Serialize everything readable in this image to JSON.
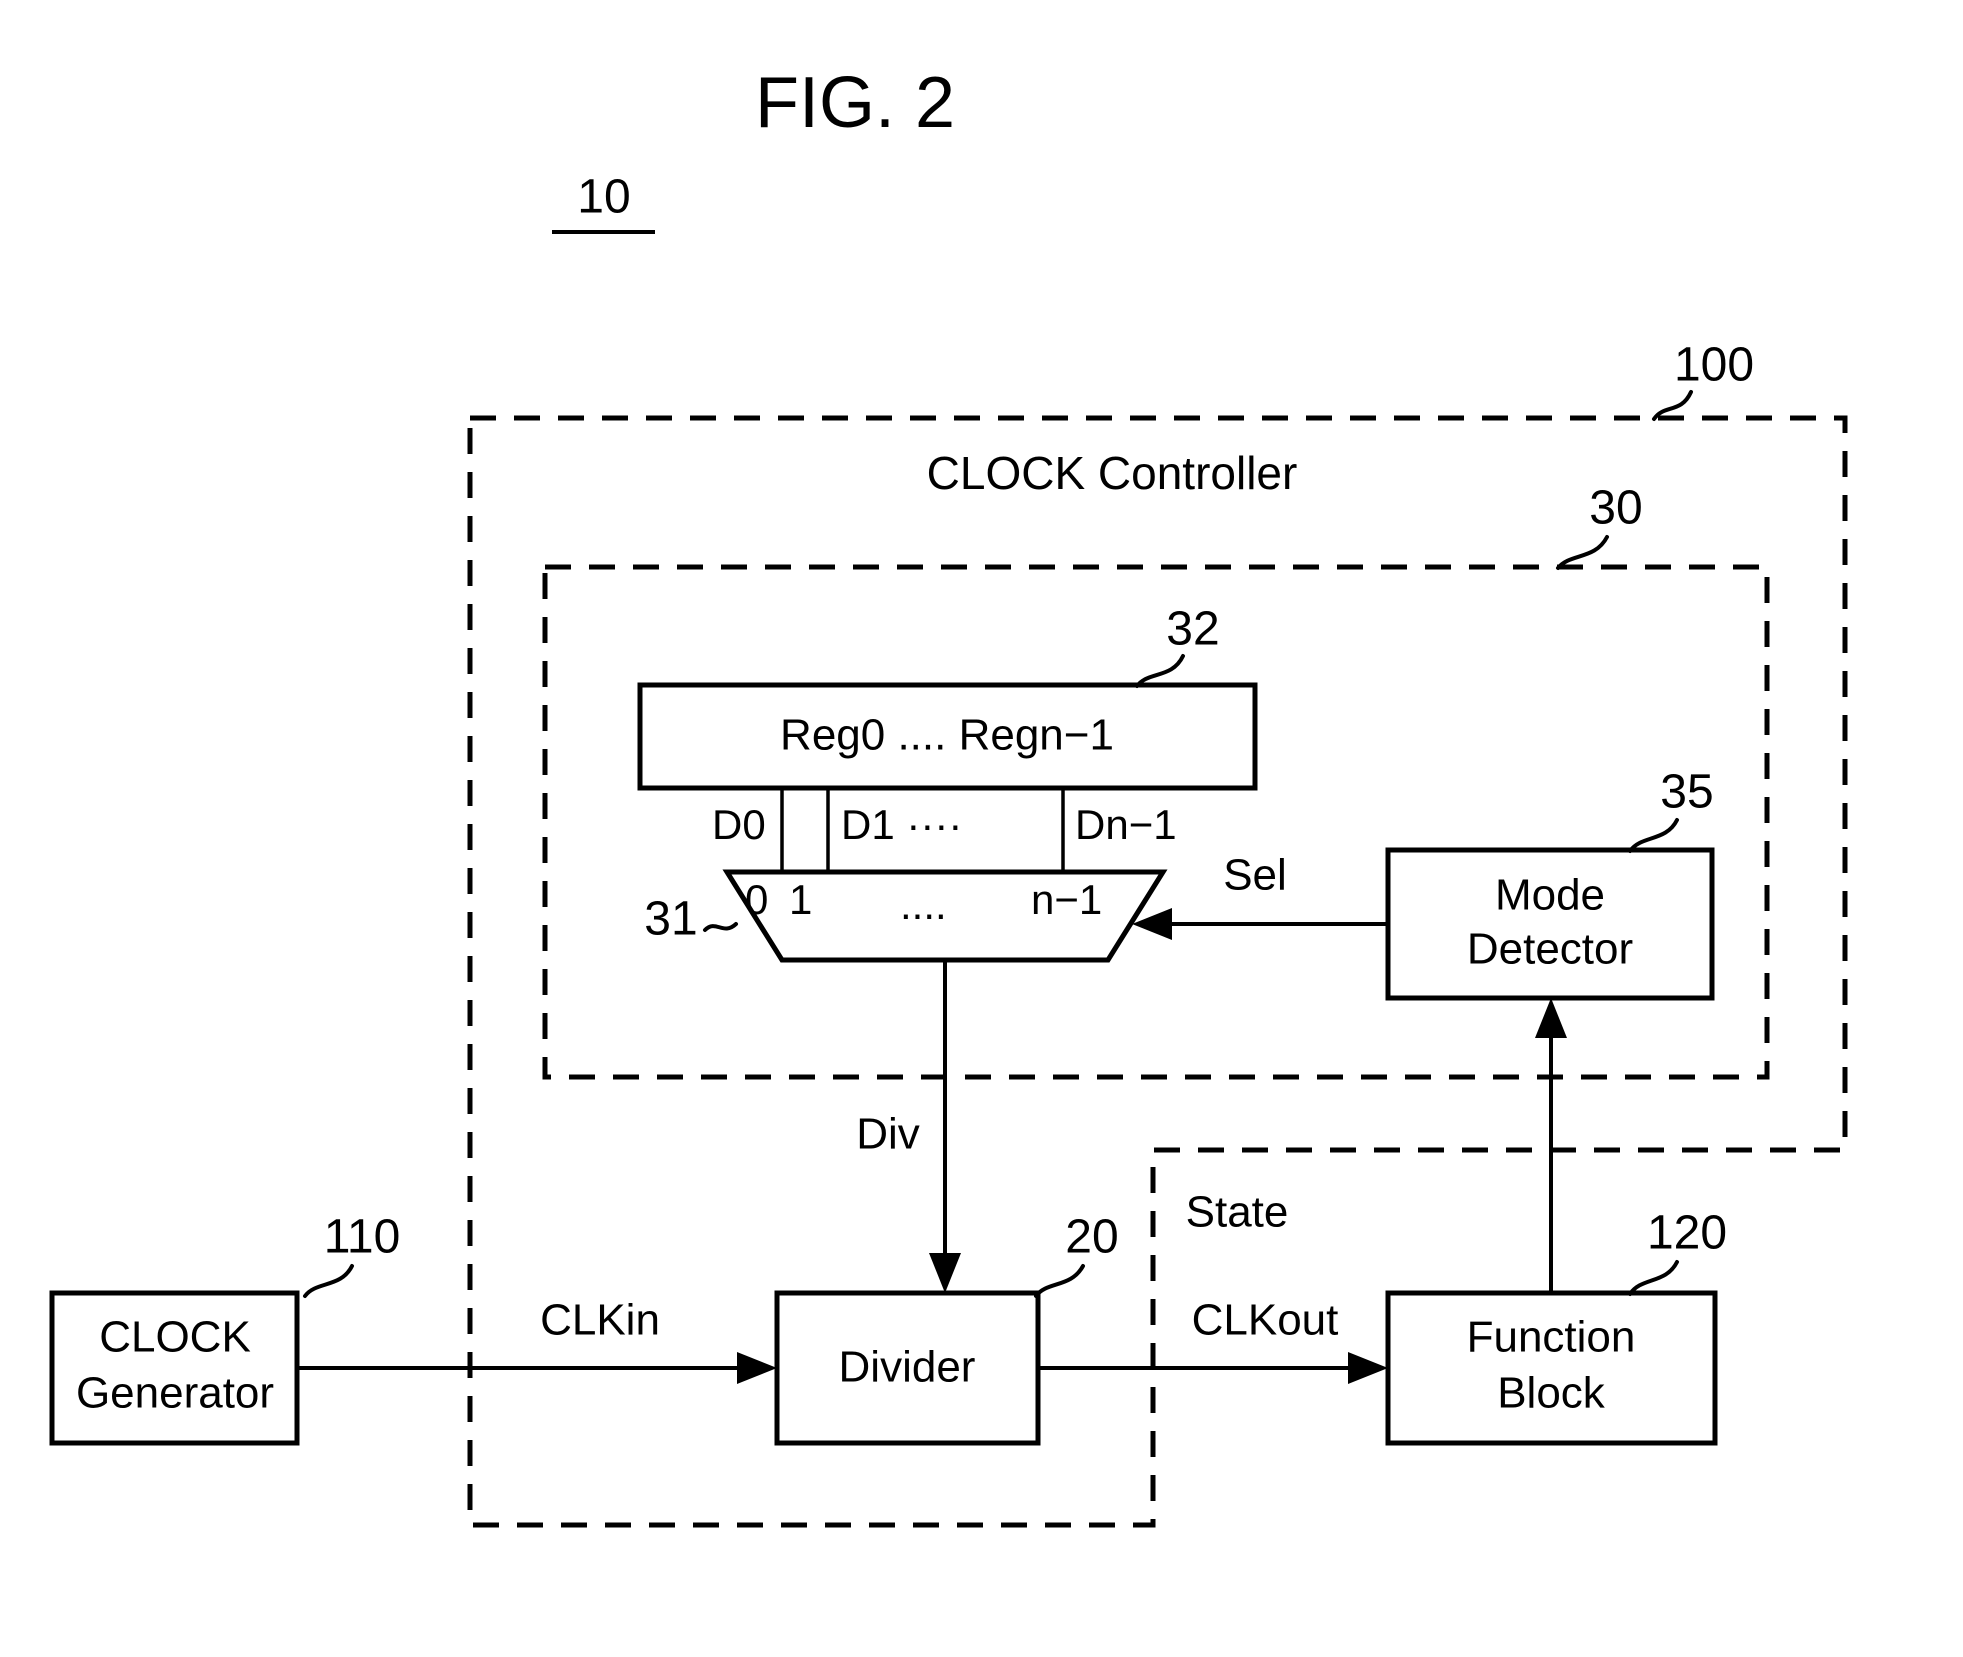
{
  "figure": {
    "title": "FIG. 2",
    "system_ref": "10"
  },
  "blocks": {
    "clock_controller": {
      "label": "CLOCK Controller",
      "ref": "100"
    },
    "divider_selector": {
      "ref": "30"
    },
    "register_bank": {
      "label": "Reg0 .... Regn−1",
      "ref": "32"
    },
    "multiplexer": {
      "ref": "31",
      "port_labels": [
        "0",
        "1",
        "....",
        "n−1"
      ]
    },
    "mode_detector": {
      "label_line1": "Mode",
      "label_line2": "Detector",
      "ref": "35"
    },
    "clock_generator": {
      "label_line1": "CLOCK",
      "label_line2": "Generator",
      "ref": "110"
    },
    "divider": {
      "label": "Divider",
      "ref": "20"
    },
    "function_block": {
      "label_line1": "Function",
      "label_line2": "Block",
      "ref": "120"
    }
  },
  "data_lines": {
    "d0": "D0",
    "d1": "D1 ····",
    "dn1": "Dn−1"
  },
  "signals": {
    "sel": "Sel",
    "div": "Div",
    "clkin": "CLKin",
    "clkout": "CLKout",
    "state": "State"
  },
  "colors": {
    "ink": "#000000",
    "paper": "#ffffff"
  }
}
